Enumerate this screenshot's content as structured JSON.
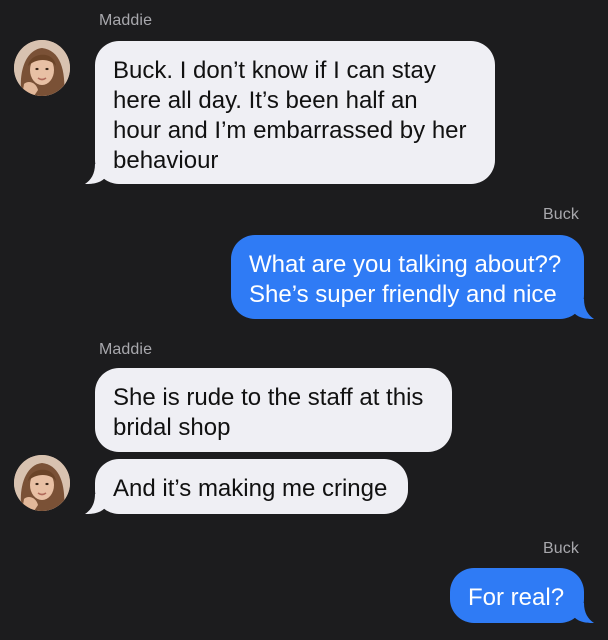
{
  "colors": {
    "background": "#1c1c1e",
    "incoming_bubble": "#efeff4",
    "outgoing_bubble": "#2f7bf5",
    "sender_name": "#a8a8ad"
  },
  "messages": [
    {
      "sender": "Maddie",
      "direction": "incoming",
      "text": "Buck. I don’t know if I can stay here all day. It’s been half an hour and I’m embarrassed by her behaviour",
      "lines": [
        "Buck. I don’t know if I can stay",
        "here all day. It’s been half an",
        "hour and I’m embarrassed by her",
        "behaviour"
      ]
    },
    {
      "sender": "Buck",
      "direction": "outgoing",
      "text": "What are you talking about?? She’s super friendly and nice",
      "lines": [
        "What are you talking about??",
        "She’s super friendly and nice"
      ]
    },
    {
      "sender": "Maddie",
      "direction": "incoming",
      "text": "She is rude to the staff at this bridal shop",
      "lines": [
        "She is rude to the staff at this",
        "bridal shop"
      ]
    },
    {
      "sender": "Maddie",
      "direction": "incoming",
      "text": "And it’s making me cringe",
      "lines": [
        "And it’s making me cringe"
      ]
    },
    {
      "sender": "Buck",
      "direction": "outgoing",
      "text": "For real?",
      "lines": [
        "For real?"
      ]
    }
  ],
  "avatars": [
    {
      "name": "maddie-avatar",
      "icon": "contact-photo"
    },
    {
      "name": "maddie-avatar",
      "icon": "contact-photo"
    }
  ]
}
